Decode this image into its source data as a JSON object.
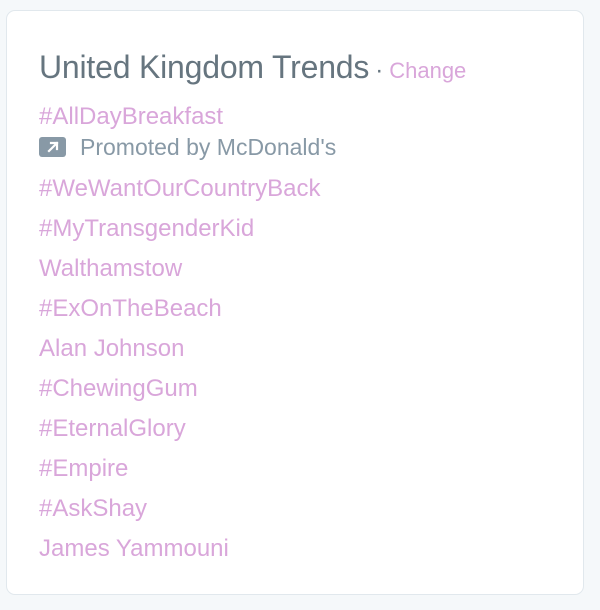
{
  "widget": {
    "title": "United Kingdom Trends",
    "separator": "·",
    "change_label": "Change"
  },
  "promoted": {
    "trend": "#AllDayBreakfast",
    "promoted_text": "Promoted by McDonald's",
    "icon": "promoted-arrow-icon"
  },
  "trends": [
    "#WeWantOurCountryBack",
    "#MyTransgenderKid",
    "Walthamstow",
    "#ExOnTheBeach",
    "Alan Johnson",
    "#ChewingGum",
    "#EternalGlory",
    "#Empire",
    "#AskShay",
    "James Yammouni"
  ],
  "colors": {
    "link": "#d9a6da",
    "title": "#66757f",
    "promo": "#8899a6",
    "border": "#e1e8ed",
    "background": "#f5f8fa"
  }
}
